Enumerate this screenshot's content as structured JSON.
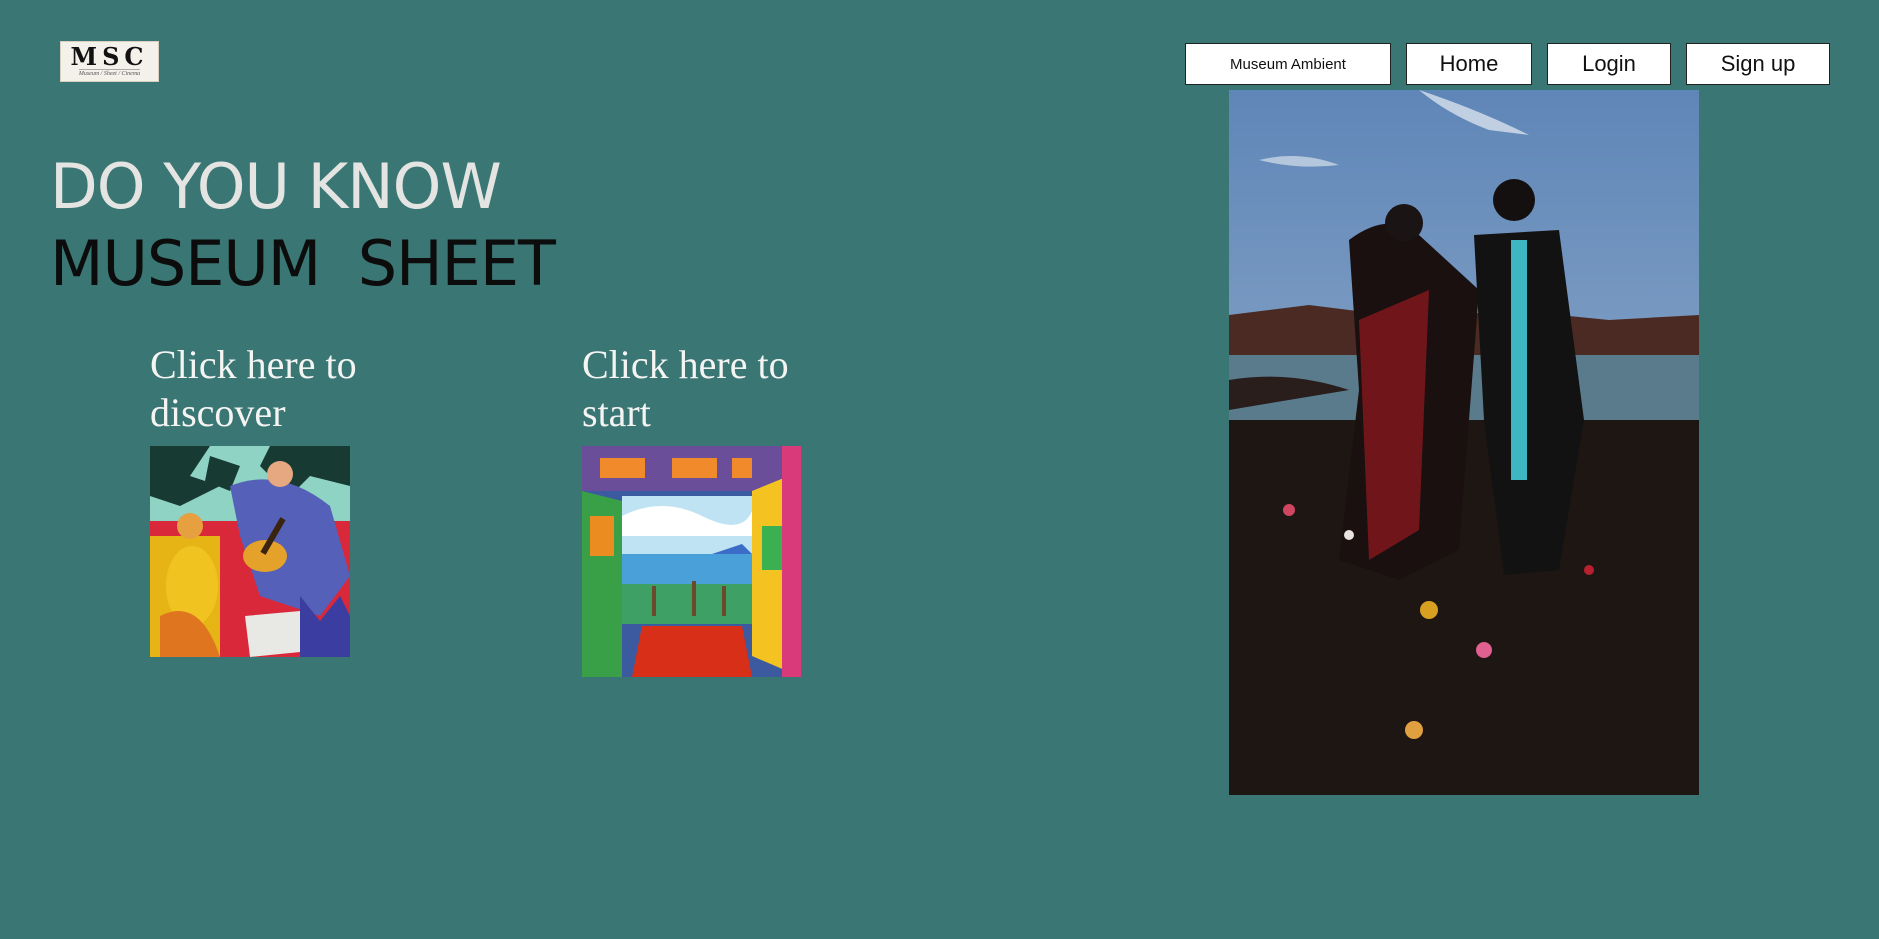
{
  "logo": {
    "text": "MSC",
    "tagline": "Museum / Sheet / Cinema"
  },
  "nav": {
    "ambient_label": "Museum Ambient",
    "home_label": "Home",
    "login_label": "Login",
    "signup_label": "Sign up"
  },
  "headline": {
    "line1": "DO YOU KNOW",
    "line2": "MUSEUM  SHEET"
  },
  "cards": {
    "discover_label": "Click here to discover",
    "start_label": "Click here to start"
  },
  "colors": {
    "background": "#3a7674",
    "headline_light": "#e4e4e2",
    "headline_dark": "#0c0c0c",
    "cta_text": "#f4f4f2"
  }
}
